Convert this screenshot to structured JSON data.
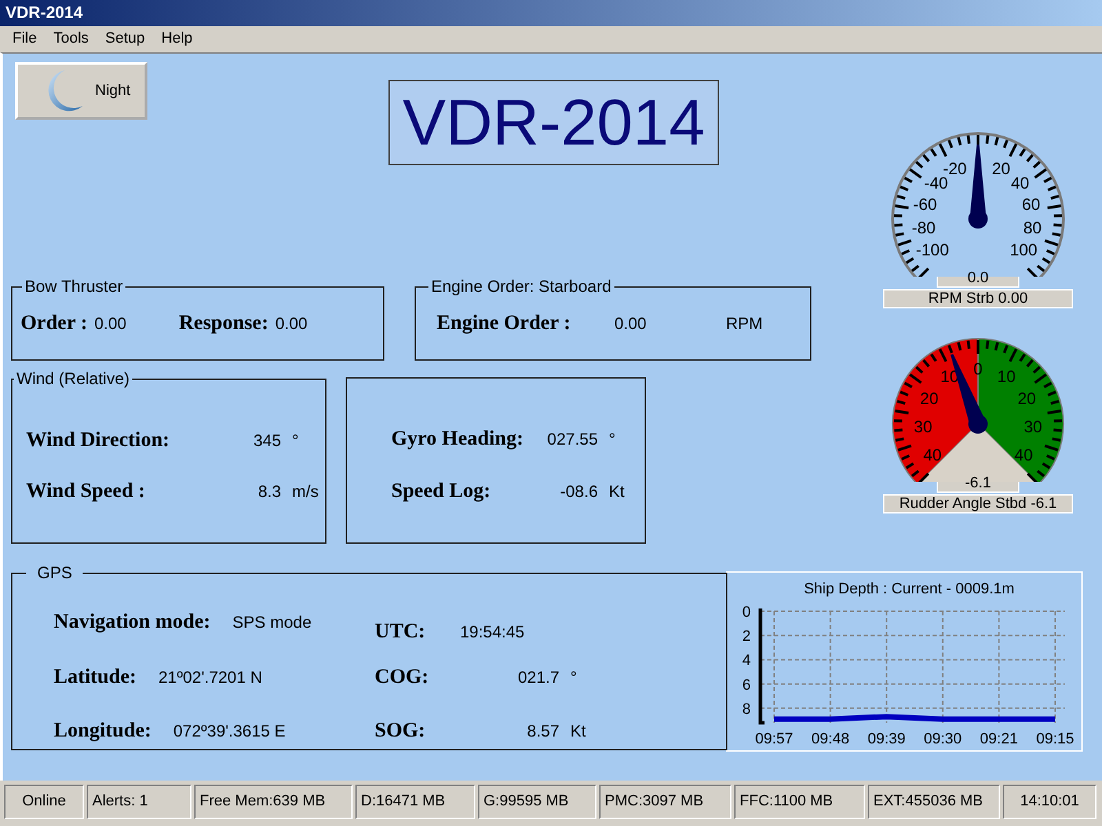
{
  "window": {
    "title": "VDR-2014"
  },
  "menu": [
    "File",
    "Tools",
    "Setup",
    "Help"
  ],
  "night_button": {
    "label": "Night"
  },
  "app_title": "VDR-2014",
  "bow_thruster": {
    "title": "Bow Thruster",
    "fields": [
      {
        "label": "Order :",
        "value": "0.00"
      },
      {
        "label": "Response:",
        "value": "0.00"
      }
    ]
  },
  "engine_order": {
    "title": "Engine Order: Starboard",
    "label": "Engine Order :",
    "value": "0.00",
    "unit": "RPM"
  },
  "wind": {
    "title": "Wind (Relative)",
    "rows": [
      {
        "label": "Wind Direction:",
        "value": "345",
        "unit": "°"
      },
      {
        "label": "Wind Speed :",
        "value": "8.3",
        "unit": "m/s"
      }
    ]
  },
  "heading": {
    "rows": [
      {
        "label": "Gyro Heading:",
        "value": "027.55",
        "unit": "°"
      },
      {
        "label": "Speed Log:",
        "value": "-08.6",
        "unit": "Kt"
      }
    ]
  },
  "gauges": [
    {
      "kind": "rpm",
      "left_labels": [
        "-20",
        "-40",
        "-60",
        "-80",
        "-100"
      ],
      "right_labels": [
        "20",
        "40",
        "60",
        "80",
        "100"
      ],
      "level": 0.5,
      "reading": "0.0",
      "caption": "RPM Strb 0.00"
    },
    {
      "kind": "rudder",
      "top_label": "0",
      "left_labels": [
        "10",
        "20",
        "30",
        "40"
      ],
      "right_labels": [
        "10",
        "20",
        "30",
        "40"
      ],
      "level": 0.42375,
      "reading": "-6.1",
      "caption": "Rudder Angle Stbd -6.1"
    }
  ],
  "gps": {
    "title": "GPS",
    "left": [
      {
        "label": "Navigation mode:",
        "value": "SPS mode"
      },
      {
        "label": "Latitude:",
        "value": "21º02'.7201 N"
      },
      {
        "label": "Longitude:",
        "value": "072º39'.3615 E"
      }
    ],
    "right": [
      {
        "label": "UTC:",
        "value": "19:54:45"
      },
      {
        "label": "COG:",
        "value": "021.7",
        "unit": "°"
      },
      {
        "label": "SOG:",
        "value": "8.57",
        "unit": "Kt"
      }
    ]
  },
  "depth_chart": {
    "chart_data": {
      "type": "line",
      "title": "Ship Depth : Current - 0009.1m",
      "categories": [
        "09:57",
        "09:48",
        "09:39",
        "09:30",
        "09:21",
        "09:15"
      ],
      "series": [
        {
          "color": "#0000c0",
          "values": [
            8.9,
            8.9,
            8.7,
            8.9,
            8.9,
            8.9
          ]
        }
      ],
      "grid": true,
      "yticks": [
        0,
        2,
        4,
        6,
        8
      ],
      "ylim": [
        9.2,
        0
      ]
    }
  },
  "status_bar": [
    "Online",
    "Alerts: 1",
    "Free Mem:639 MB",
    "D:16471 MB",
    "G:99595 MB",
    "PMC:3097 MB",
    "FFC:1100 MB",
    "EXT:455036 MB",
    "14:10:01"
  ]
}
